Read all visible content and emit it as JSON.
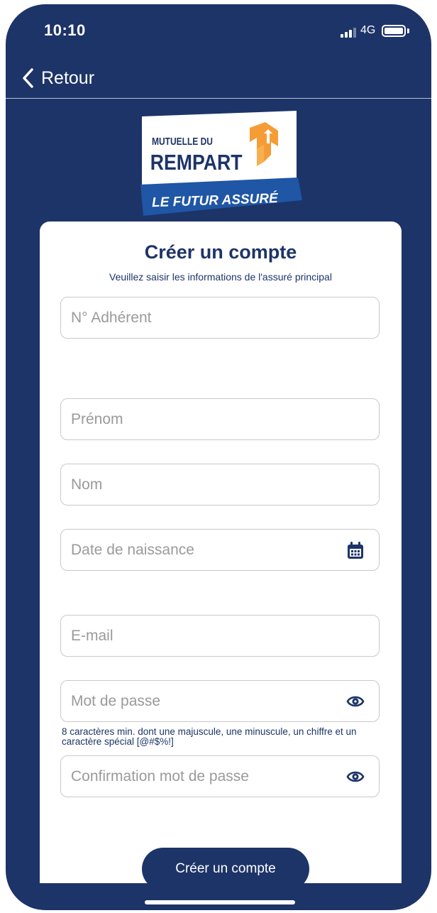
{
  "status_bar": {
    "time": "10:10",
    "network": "4G"
  },
  "nav": {
    "back_label": "Retour"
  },
  "logo": {
    "line1": "MUTUELLE DU",
    "line2": "REMPART",
    "tagline": "LE FUTUR ASSURÉ"
  },
  "form": {
    "title": "Créer un compte",
    "subtitle": "Veuillez saisir les informations de l'assuré principal",
    "member_number": {
      "placeholder": "N° Adhérent",
      "value": ""
    },
    "first_name": {
      "placeholder": "Prénom",
      "value": ""
    },
    "last_name": {
      "placeholder": "Nom",
      "value": ""
    },
    "birth_date": {
      "placeholder": "Date de naissance",
      "value": "",
      "icon": "calendar-icon"
    },
    "email": {
      "placeholder": "E-mail",
      "value": ""
    },
    "password": {
      "placeholder": "Mot de passe",
      "value": "",
      "icon": "eye-icon"
    },
    "password_hint": "8 caractères min. dont une majuscule, une minuscule, un chiffre et un caractère spécial [@#$%!]",
    "password_confirm": {
      "placeholder": "Confirmation mot de passe",
      "value": "",
      "icon": "eye-icon"
    },
    "submit_label": "Créer un compte"
  },
  "colors": {
    "brand_navy": "#1d3468",
    "brand_orange": "#f59c36",
    "field_border": "#c9c9c9"
  }
}
